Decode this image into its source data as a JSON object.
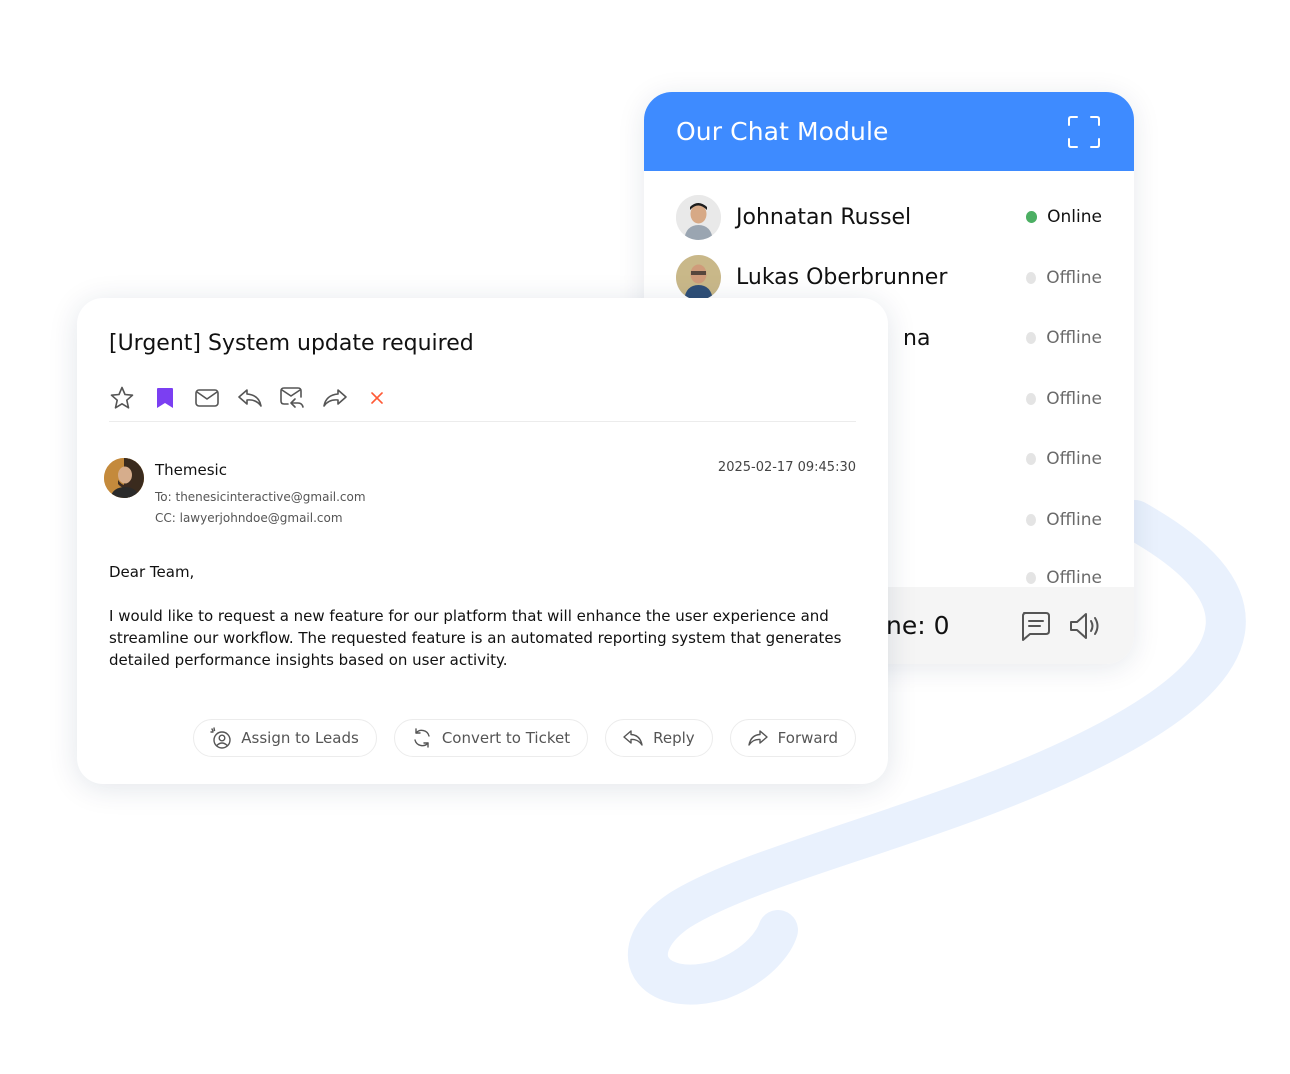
{
  "colors": {
    "accent": "#3e8bff",
    "online": "#4caf63",
    "offline": "#e4e4e4",
    "bookmark": "#7b3ff2",
    "close": "#ff5a36",
    "swirl": "#e9f1fd"
  },
  "chat": {
    "title": "Our Chat Module",
    "users": [
      {
        "name": "Johnatan Russel",
        "status": "Online"
      },
      {
        "name": "Lukas Oberbrunner",
        "status": "Offline"
      },
      {
        "name": "na",
        "status": "Offline"
      },
      {
        "name": "",
        "status": "Offline"
      },
      {
        "name": "",
        "status": "Offline"
      },
      {
        "name": "",
        "status": "Offline"
      },
      {
        "name": "",
        "status": "Offline"
      }
    ],
    "footer_text": "ne: 0"
  },
  "email": {
    "subject": "[Urgent] System update required",
    "toolbar_icons": [
      "star-icon",
      "bookmark-icon",
      "mail-icon",
      "reply-icon",
      "reply-all-icon",
      "forward-icon",
      "close-icon"
    ],
    "sender": "Themesic",
    "date": "2025-02-17 09:45:30",
    "to": "To: thenesicinteractive@gmail.com",
    "cc": "CC: lawyerjohndoe@gmail.com",
    "greeting": "Dear Team,",
    "body": "I would like to request a new feature for our platform that will enhance the user experience and streamline our workflow. The requested feature is an automated reporting system that generates detailed performance insights based on user activity.",
    "actions": {
      "assign": "Assign to Leads",
      "convert": "Convert to Ticket",
      "reply": "Reply",
      "forward": "Forward"
    }
  }
}
